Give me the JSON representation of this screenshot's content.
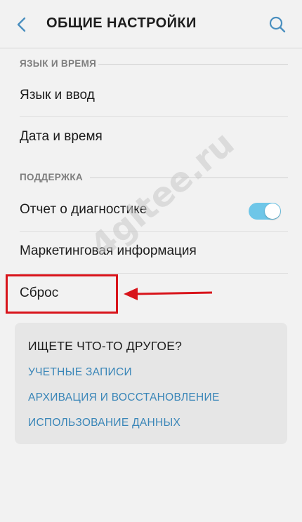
{
  "header": {
    "title": "ОБЩИЕ НАСТРОЙКИ",
    "back_icon": "back-chevron-icon",
    "search_icon": "search-icon"
  },
  "sections": [
    {
      "title": "ЯЗЫК И ВРЕМЯ",
      "items": [
        {
          "label": "Язык и ввод"
        },
        {
          "label": "Дата и время"
        }
      ]
    },
    {
      "title": "ПОДДЕРЖКА",
      "items": [
        {
          "label": "Отчет о диагностике",
          "toggle": true
        },
        {
          "label": "Маркетинговая информация"
        },
        {
          "label": "Сброс",
          "highlighted": true
        }
      ]
    }
  ],
  "card": {
    "title": "ИЩЕТЕ ЧТО-ТО ДРУГОЕ?",
    "links": [
      "УЧЕТНЫЕ ЗАПИСИ",
      "АРХИВАЦИЯ И ВОССТАНОВЛЕНИЕ",
      "ИСПОЛЬЗОВАНИЕ ДАННЫХ"
    ]
  },
  "watermark": "4gltee.ru",
  "colors": {
    "accent": "#3a86b8",
    "toggle_on": "#6ec6e8",
    "highlight": "#d8141b",
    "background": "#f2f2f2"
  }
}
